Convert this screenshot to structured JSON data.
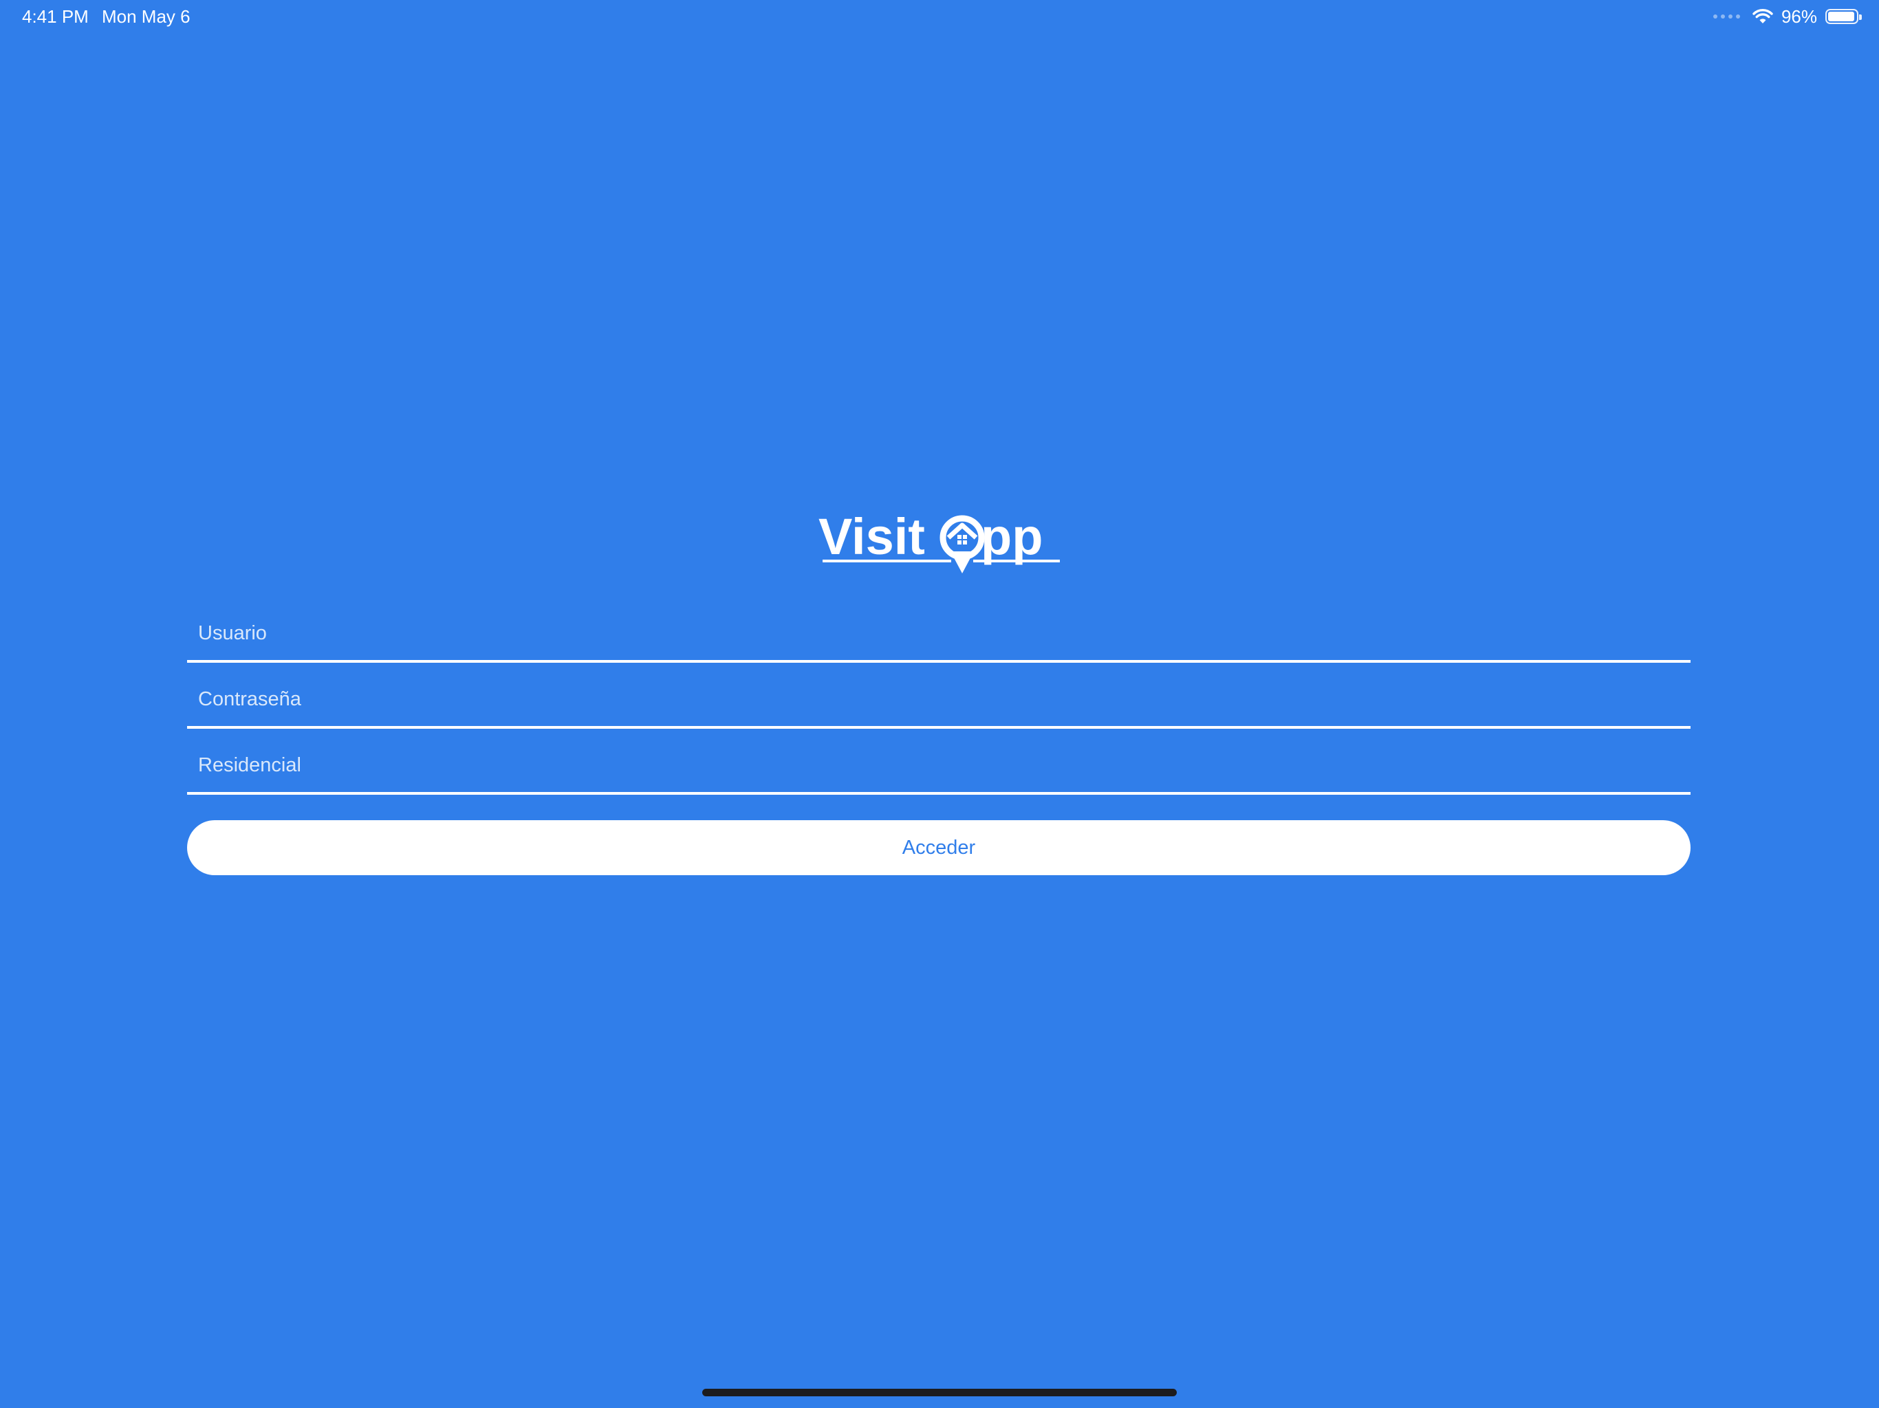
{
  "status_bar": {
    "time": "4:41 PM",
    "date": "Mon May 6",
    "battery_percent": "96%",
    "battery_level": 0.96,
    "icons": [
      "cellular-dots-icon",
      "wifi-icon",
      "battery-icon"
    ]
  },
  "logo": {
    "text_left": "Visit",
    "text_right": "pp",
    "icon": "location-pin-house-icon"
  },
  "login_form": {
    "username": {
      "value": "",
      "placeholder": "Usuario"
    },
    "password": {
      "value": "",
      "placeholder": "Contraseña"
    },
    "residential": {
      "value": "",
      "placeholder": "Residencial"
    },
    "submit_label": "Acceder"
  },
  "colors": {
    "background": "#307EEA",
    "button_background": "#FFFFFF",
    "button_text": "#307EEA",
    "text": "#FFFFFF"
  }
}
